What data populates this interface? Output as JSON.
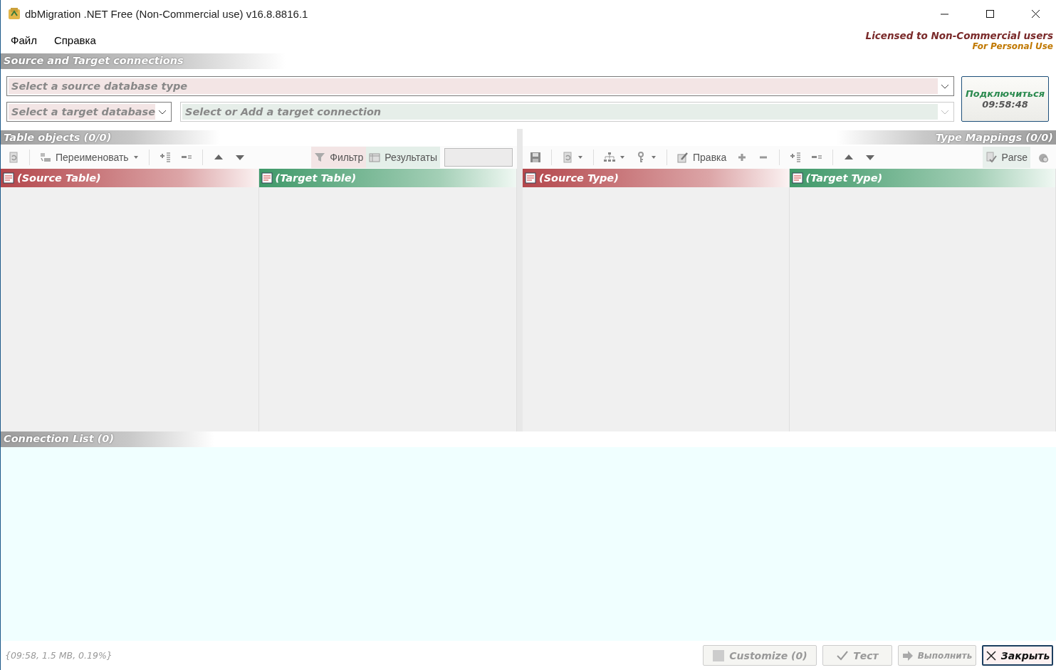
{
  "window": {
    "title": "dbMigration .NET Free (Non-Commercial use) v16.8.8816.1"
  },
  "menu": [
    {
      "label": "Файл"
    },
    {
      "label": "Справка"
    }
  ],
  "license": {
    "line1": "Licensed to Non-Commercial users",
    "line2": "For Personal Use"
  },
  "connections": {
    "title": "Source and Target connections",
    "source_select": {
      "placeholder": "Select a source database type",
      "disabled": false
    },
    "target_db_select": {
      "placeholder": "Select a target database",
      "disabled": false
    },
    "target_connection_select": {
      "placeholder": "Select or Add a target connection",
      "disabled": true
    },
    "connect_button": {
      "label": "Подключиться",
      "time": "09:58:48"
    }
  },
  "table_objects": {
    "title": "Table objects (0/0)",
    "rename_button": "Переименовать",
    "filter_button": "Фильтр",
    "results_button": "Результаты",
    "columns": [
      {
        "label": "(Source Table)",
        "kind": "source"
      },
      {
        "label": "(Target Table)",
        "kind": "target"
      }
    ]
  },
  "type_mappings": {
    "title": "Type Mappings (0/0)",
    "edit_button": "Правка",
    "parse_button": "Parse",
    "columns": [
      {
        "label": "(Source Type)",
        "kind": "source"
      },
      {
        "label": "(Target Type)",
        "kind": "target"
      }
    ]
  },
  "connection_list": {
    "title": "Connection List (0)"
  },
  "status_bar": {
    "text": "{09:58, 1.5 MB, 0.19%}"
  },
  "buttons": [
    {
      "label": "Customize (0)",
      "kind": "customize",
      "disabled": true
    },
    {
      "label": "Тест",
      "kind": "test",
      "disabled": true
    },
    {
      "label": "Выполнить",
      "kind": "run",
      "disabled": true
    },
    {
      "label": "Закрыть",
      "kind": "close",
      "disabled": false
    }
  ]
}
